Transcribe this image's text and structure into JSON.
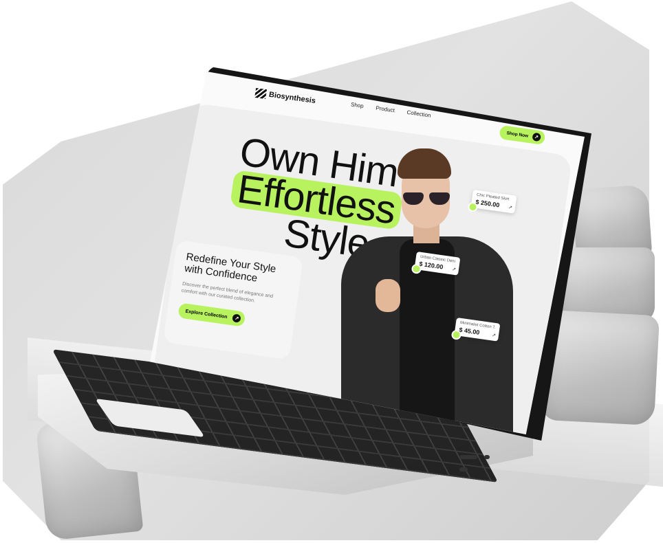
{
  "site": {
    "brand": "Biosynthesis"
  },
  "nav": {
    "links": [
      "Shop",
      "Product",
      "Collection"
    ],
    "cta": "Shop Now"
  },
  "hero": {
    "line1": "Own Him",
    "line2": "Effortless",
    "line3": "Style",
    "card_title": "Redefine Your Style with Confidence",
    "card_desc": "Discover the perfect blend of elegance and comfort with our curated collection.",
    "card_cta": "Explore Collection"
  },
  "products": [
    {
      "name": "Chic Pleated Skirt",
      "price": "$ 250.00"
    },
    {
      "name": "Urban Classic Deni...",
      "price": "$ 120.00"
    },
    {
      "name": "Minimalist Cotton T...",
      "price": "$ 45.00"
    }
  ],
  "colors": {
    "accent": "#b8f25e",
    "dark": "#111111",
    "panel": "#efefef"
  }
}
